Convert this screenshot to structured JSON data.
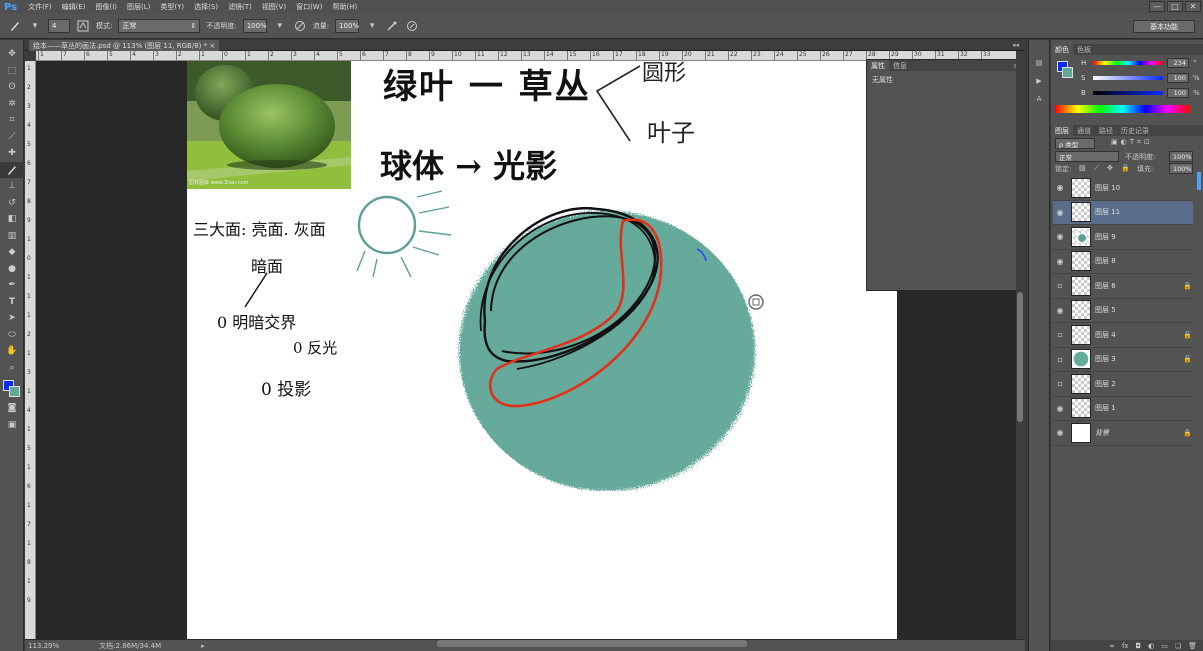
{
  "app": {
    "logo": "Ps"
  },
  "menu": [
    "文件(F)",
    "编辑(E)",
    "图像(I)",
    "图层(L)",
    "类型(Y)",
    "选择(S)",
    "滤镜(T)",
    "视图(V)",
    "窗口(W)",
    "帮助(H)"
  ],
  "window_controls": [
    "—",
    "□",
    "✕"
  ],
  "options": {
    "brush_size": "4",
    "mode_label": "模式:",
    "mode_value": "正常",
    "opacity_label": "不透明度:",
    "opacity_value": "100%",
    "flow_label": "流量:",
    "flow_value": "100%",
    "workspace": "基本功能"
  },
  "document": {
    "tab_title": "绘本——草丛的画法.psd @ 113% (图层 11, RGB/8) * ×",
    "zoom": "113.29%",
    "doc_size": "文档:2.86M/34.4M"
  },
  "ruler_ticks": [
    "1",
    "7",
    "6",
    "5",
    "4",
    "3",
    "2",
    "1",
    "0",
    "1",
    "2",
    "3",
    "4",
    "5",
    "6",
    "7",
    "8",
    "9",
    "10",
    "11",
    "12",
    "13",
    "14",
    "15",
    "16",
    "17",
    "18",
    "19",
    "20",
    "21",
    "22",
    "23",
    "24",
    "25",
    "26",
    "27",
    "28",
    "29",
    "30",
    "31",
    "32",
    "33"
  ],
  "vruler_ticks": [
    "1",
    "2",
    "3",
    "4",
    "5",
    "6",
    "7",
    "8",
    "9",
    "1",
    "0",
    "1",
    "1",
    "1",
    "2",
    "1",
    "3",
    "1",
    "4",
    "1",
    "5",
    "1",
    "6",
    "1",
    "7",
    "1",
    "8",
    "1",
    "9"
  ],
  "canvas_text": {
    "title1": "绿叶 一 草丛",
    "branch1": "圆形",
    "branch2": "叶子",
    "title2": "球体 → 光影",
    "note1": "三大面: 亮面. 灰面",
    "note2": "暗面",
    "note3": "0 明暗交界",
    "note4": "0 反光",
    "note5": "0 投影",
    "photo_watermark": "园林图库 www.3lian.com"
  },
  "props_panel": {
    "tabs": [
      "属性",
      "信息"
    ],
    "body": "无属性"
  },
  "color_panel": {
    "tabs": [
      "颜色",
      "色板"
    ],
    "rows": [
      {
        "label": "H",
        "value": "234",
        "unit": "°"
      },
      {
        "label": "S",
        "value": "100",
        "unit": "%"
      },
      {
        "label": "B",
        "value": "100",
        "unit": "%"
      }
    ],
    "hue_pos": 0.65,
    "foreground": "#0a2bff",
    "background": "#62a898"
  },
  "layers_panel": {
    "tabs": [
      "图层",
      "通道",
      "路径",
      "历史记录"
    ],
    "filter": "ρ 类型",
    "blend": "正常",
    "opacity_label": "不透明度:",
    "opacity": "100%",
    "lock_label": "锁定:",
    "fill_label": "填充:",
    "fill": "100%",
    "layers": [
      {
        "name": "图层 10",
        "visible": true,
        "selected": false,
        "lock": false,
        "thumb": "empty"
      },
      {
        "name": "图层 11",
        "visible": true,
        "selected": true,
        "lock": false,
        "thumb": "empty"
      },
      {
        "name": "图层 9",
        "visible": true,
        "selected": false,
        "lock": false,
        "thumb": "dot"
      },
      {
        "name": "图层 8",
        "visible": true,
        "selected": false,
        "lock": false,
        "thumb": "empty"
      },
      {
        "name": "图层 6",
        "visible": false,
        "selected": false,
        "lock": true,
        "thumb": "empty"
      },
      {
        "name": "图层 5",
        "visible": true,
        "selected": false,
        "lock": false,
        "thumb": "empty"
      },
      {
        "name": "图层 4",
        "visible": false,
        "selected": false,
        "lock": true,
        "thumb": "empty"
      },
      {
        "name": "图层 3",
        "visible": false,
        "selected": false,
        "lock": true,
        "thumb": "ball"
      },
      {
        "name": "图层 2",
        "visible": false,
        "selected": false,
        "lock": false,
        "thumb": "empty"
      },
      {
        "name": "图层 1",
        "visible": true,
        "selected": false,
        "lock": false,
        "thumb": "empty"
      },
      {
        "name": "背景",
        "visible": true,
        "selected": false,
        "lock": true,
        "thumb": "white"
      }
    ],
    "bottom_icons": [
      "∞",
      "fx",
      "◘",
      "◐",
      "▭",
      "❏",
      "🗑"
    ]
  }
}
